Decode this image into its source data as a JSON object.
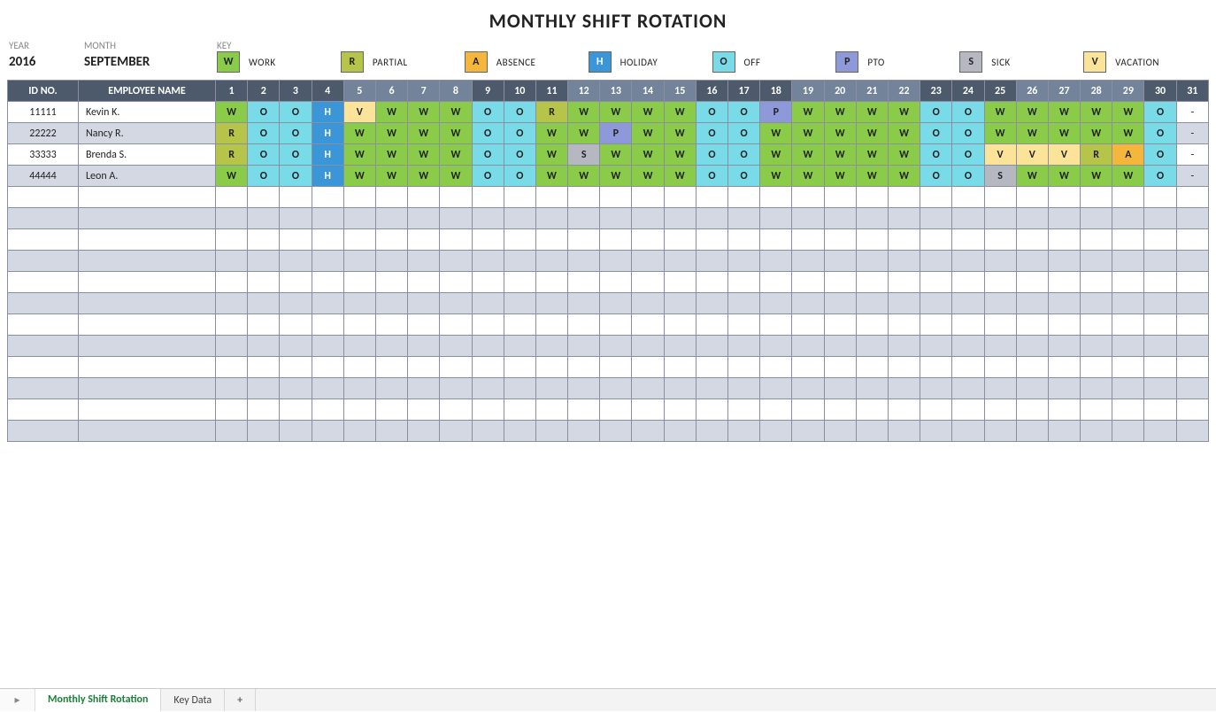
{
  "title": "MONTHLY SHIFT ROTATION",
  "labels": {
    "year": "YEAR",
    "month": "MONTH",
    "key": "KEY",
    "id": "ID NO.",
    "name": "EMPLOYEE NAME"
  },
  "year": "2016",
  "month": "SEPTEMBER",
  "days_in_month": 31,
  "day_header_light": [
    5,
    6,
    7,
    8,
    12,
    13,
    14,
    15,
    19,
    20,
    21,
    22,
    26,
    27,
    28,
    29
  ],
  "legend": [
    {
      "code": "W",
      "label": "WORK"
    },
    {
      "code": "R",
      "label": "PARTIAL"
    },
    {
      "code": "A",
      "label": "ABSENCE"
    },
    {
      "code": "H",
      "label": "HOLIDAY"
    },
    {
      "code": "O",
      "label": "OFF"
    },
    {
      "code": "P",
      "label": "PTO"
    },
    {
      "code": "S",
      "label": "SICK"
    },
    {
      "code": "V",
      "label": "VACATION"
    }
  ],
  "employees": [
    {
      "id": "11111",
      "name": "Kevin K.",
      "schedule": [
        "W",
        "O",
        "O",
        "H",
        "V",
        "W",
        "W",
        "W",
        "O",
        "O",
        "R",
        "W",
        "W",
        "W",
        "W",
        "O",
        "O",
        "P",
        "W",
        "W",
        "W",
        "W",
        "O",
        "O",
        "W",
        "W",
        "W",
        "W",
        "W",
        "O",
        "-"
      ]
    },
    {
      "id": "22222",
      "name": "Nancy R.",
      "schedule": [
        "R",
        "O",
        "O",
        "H",
        "W",
        "W",
        "W",
        "W",
        "O",
        "O",
        "W",
        "W",
        "P",
        "W",
        "W",
        "O",
        "O",
        "W",
        "W",
        "W",
        "W",
        "W",
        "O",
        "O",
        "W",
        "W",
        "W",
        "W",
        "W",
        "O",
        "-"
      ]
    },
    {
      "id": "33333",
      "name": "Brenda S.",
      "schedule": [
        "R",
        "O",
        "O",
        "H",
        "W",
        "W",
        "W",
        "W",
        "O",
        "O",
        "W",
        "S",
        "W",
        "W",
        "W",
        "O",
        "O",
        "W",
        "W",
        "W",
        "W",
        "W",
        "O",
        "O",
        "V",
        "V",
        "V",
        "R",
        "A",
        "O",
        "-"
      ]
    },
    {
      "id": "44444",
      "name": "Leon A.",
      "schedule": [
        "W",
        "O",
        "O",
        "H",
        "W",
        "W",
        "W",
        "W",
        "O",
        "O",
        "W",
        "W",
        "W",
        "W",
        "W",
        "O",
        "O",
        "W",
        "W",
        "W",
        "W",
        "W",
        "O",
        "O",
        "S",
        "W",
        "W",
        "W",
        "W",
        "O",
        "-"
      ]
    }
  ],
  "empty_rows": 12,
  "tabs": {
    "nav_icon": "▸",
    "items": [
      "Monthly Shift Rotation",
      "Key Data"
    ],
    "active": 0,
    "add": "+"
  }
}
